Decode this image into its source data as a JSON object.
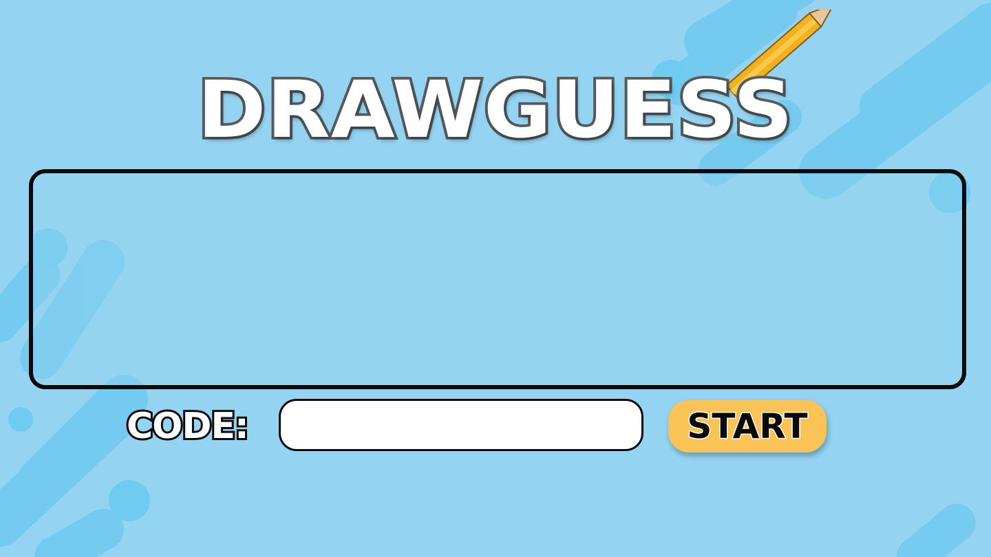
{
  "app": {
    "title": "DRAWGUESS"
  },
  "main": {
    "code_label": "CODE:",
    "code_value": "",
    "start_label": "START"
  },
  "colors": {
    "background": "#94d4f2",
    "background_shapes": "#6fcbef",
    "board_border": "#0a0a0a",
    "start_button": "#f9c455",
    "title_stroke": "#555a5d"
  },
  "icons": {
    "logo_decoration": "pencil-icon"
  }
}
